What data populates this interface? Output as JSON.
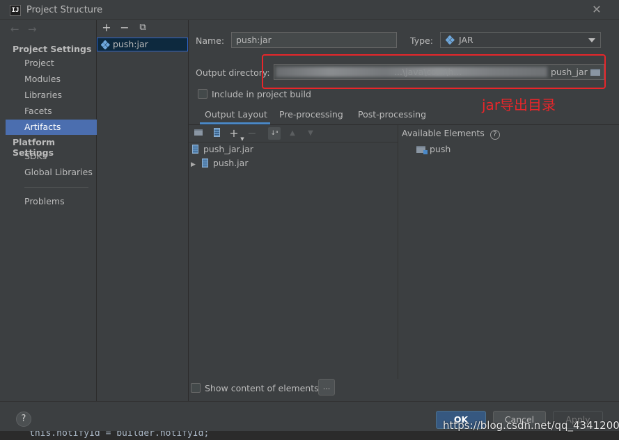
{
  "window": {
    "title": "Project Structure",
    "app_icon_text": "IJ",
    "close_glyph": "✕"
  },
  "nav": {
    "back_glyph": "←",
    "forward_glyph": "→",
    "project_settings_heading": "Project Settings",
    "project_settings_items": [
      "Project",
      "Modules",
      "Libraries",
      "Facets",
      "Artifacts"
    ],
    "selected_item": "Artifacts",
    "platform_settings_heading": "Platform Settings",
    "platform_settings_items": [
      "SDKs",
      "Global Libraries"
    ],
    "problems": "Problems"
  },
  "artifact_list": {
    "add_glyph": "+",
    "remove_glyph": "−",
    "copy_glyph": "⧉",
    "items": [
      "push:jar"
    ]
  },
  "editor": {
    "name_label": "Name:",
    "name_value": "push:jar",
    "type_label": "Type:",
    "type_value": "JAR",
    "output_dir_label": "Output directory:",
    "output_dir_value_visible_start": "",
    "output_dir_value_mid": "...\\java\\com\\h...",
    "output_dir_value_end": "push_jar",
    "include_in_build_label": "Include in project build",
    "include_in_build_checked": false,
    "tabs": [
      "Output Layout",
      "Pre-processing",
      "Post-processing"
    ],
    "active_tab": "Output Layout",
    "available_elements_label": "Available Elements",
    "help_glyph": "?",
    "tree": {
      "root": "push_jar.jar",
      "children": [
        {
          "label": "push.jar",
          "expand_glyph": "▶"
        }
      ]
    },
    "available_elements": [
      "push"
    ],
    "show_content_label": "Show content of elements",
    "show_content_checked": false,
    "ellipsis_button": "..."
  },
  "annotation": {
    "text": "jar导出目录",
    "color": "#e8262a"
  },
  "footer": {
    "help_glyph": "?",
    "ok_label": "OK",
    "cancel_label": "Cancel",
    "apply_label": "Apply",
    "code_peek": "this.notifyId = builder.notifyId;",
    "watermark": "https://blog.csdn.net/qq_43412005"
  },
  "colors": {
    "background": "#3c3f41",
    "selection": "#4b6eaf",
    "accent": "#4a88c7",
    "annotation": "#e8262a"
  }
}
